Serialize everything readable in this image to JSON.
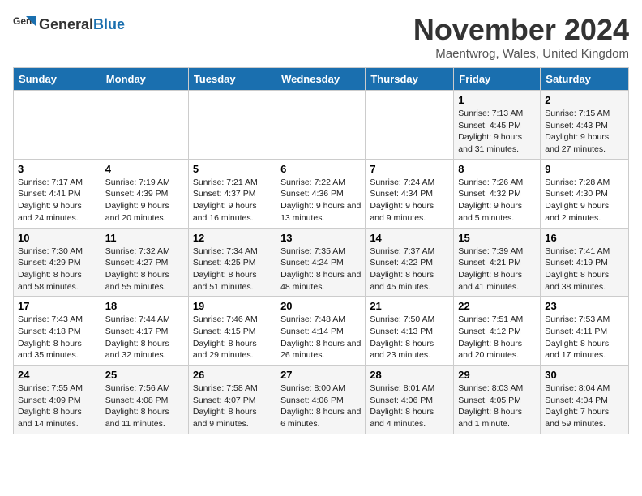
{
  "logo": {
    "general": "General",
    "blue": "Blue"
  },
  "title": "November 2024",
  "location": "Maentwrog, Wales, United Kingdom",
  "weekdays": [
    "Sunday",
    "Monday",
    "Tuesday",
    "Wednesday",
    "Thursday",
    "Friday",
    "Saturday"
  ],
  "weeks": [
    [
      {
        "day": "",
        "info": ""
      },
      {
        "day": "",
        "info": ""
      },
      {
        "day": "",
        "info": ""
      },
      {
        "day": "",
        "info": ""
      },
      {
        "day": "",
        "info": ""
      },
      {
        "day": "1",
        "info": "Sunrise: 7:13 AM\nSunset: 4:45 PM\nDaylight: 9 hours and 31 minutes."
      },
      {
        "day": "2",
        "info": "Sunrise: 7:15 AM\nSunset: 4:43 PM\nDaylight: 9 hours and 27 minutes."
      }
    ],
    [
      {
        "day": "3",
        "info": "Sunrise: 7:17 AM\nSunset: 4:41 PM\nDaylight: 9 hours and 24 minutes."
      },
      {
        "day": "4",
        "info": "Sunrise: 7:19 AM\nSunset: 4:39 PM\nDaylight: 9 hours and 20 minutes."
      },
      {
        "day": "5",
        "info": "Sunrise: 7:21 AM\nSunset: 4:37 PM\nDaylight: 9 hours and 16 minutes."
      },
      {
        "day": "6",
        "info": "Sunrise: 7:22 AM\nSunset: 4:36 PM\nDaylight: 9 hours and 13 minutes."
      },
      {
        "day": "7",
        "info": "Sunrise: 7:24 AM\nSunset: 4:34 PM\nDaylight: 9 hours and 9 minutes."
      },
      {
        "day": "8",
        "info": "Sunrise: 7:26 AM\nSunset: 4:32 PM\nDaylight: 9 hours and 5 minutes."
      },
      {
        "day": "9",
        "info": "Sunrise: 7:28 AM\nSunset: 4:30 PM\nDaylight: 9 hours and 2 minutes."
      }
    ],
    [
      {
        "day": "10",
        "info": "Sunrise: 7:30 AM\nSunset: 4:29 PM\nDaylight: 8 hours and 58 minutes."
      },
      {
        "day": "11",
        "info": "Sunrise: 7:32 AM\nSunset: 4:27 PM\nDaylight: 8 hours and 55 minutes."
      },
      {
        "day": "12",
        "info": "Sunrise: 7:34 AM\nSunset: 4:25 PM\nDaylight: 8 hours and 51 minutes."
      },
      {
        "day": "13",
        "info": "Sunrise: 7:35 AM\nSunset: 4:24 PM\nDaylight: 8 hours and 48 minutes."
      },
      {
        "day": "14",
        "info": "Sunrise: 7:37 AM\nSunset: 4:22 PM\nDaylight: 8 hours and 45 minutes."
      },
      {
        "day": "15",
        "info": "Sunrise: 7:39 AM\nSunset: 4:21 PM\nDaylight: 8 hours and 41 minutes."
      },
      {
        "day": "16",
        "info": "Sunrise: 7:41 AM\nSunset: 4:19 PM\nDaylight: 8 hours and 38 minutes."
      }
    ],
    [
      {
        "day": "17",
        "info": "Sunrise: 7:43 AM\nSunset: 4:18 PM\nDaylight: 8 hours and 35 minutes."
      },
      {
        "day": "18",
        "info": "Sunrise: 7:44 AM\nSunset: 4:17 PM\nDaylight: 8 hours and 32 minutes."
      },
      {
        "day": "19",
        "info": "Sunrise: 7:46 AM\nSunset: 4:15 PM\nDaylight: 8 hours and 29 minutes."
      },
      {
        "day": "20",
        "info": "Sunrise: 7:48 AM\nSunset: 4:14 PM\nDaylight: 8 hours and 26 minutes."
      },
      {
        "day": "21",
        "info": "Sunrise: 7:50 AM\nSunset: 4:13 PM\nDaylight: 8 hours and 23 minutes."
      },
      {
        "day": "22",
        "info": "Sunrise: 7:51 AM\nSunset: 4:12 PM\nDaylight: 8 hours and 20 minutes."
      },
      {
        "day": "23",
        "info": "Sunrise: 7:53 AM\nSunset: 4:11 PM\nDaylight: 8 hours and 17 minutes."
      }
    ],
    [
      {
        "day": "24",
        "info": "Sunrise: 7:55 AM\nSunset: 4:09 PM\nDaylight: 8 hours and 14 minutes."
      },
      {
        "day": "25",
        "info": "Sunrise: 7:56 AM\nSunset: 4:08 PM\nDaylight: 8 hours and 11 minutes."
      },
      {
        "day": "26",
        "info": "Sunrise: 7:58 AM\nSunset: 4:07 PM\nDaylight: 8 hours and 9 minutes."
      },
      {
        "day": "27",
        "info": "Sunrise: 8:00 AM\nSunset: 4:06 PM\nDaylight: 8 hours and 6 minutes."
      },
      {
        "day": "28",
        "info": "Sunrise: 8:01 AM\nSunset: 4:06 PM\nDaylight: 8 hours and 4 minutes."
      },
      {
        "day": "29",
        "info": "Sunrise: 8:03 AM\nSunset: 4:05 PM\nDaylight: 8 hours and 1 minute."
      },
      {
        "day": "30",
        "info": "Sunrise: 8:04 AM\nSunset: 4:04 PM\nDaylight: 7 hours and 59 minutes."
      }
    ]
  ]
}
